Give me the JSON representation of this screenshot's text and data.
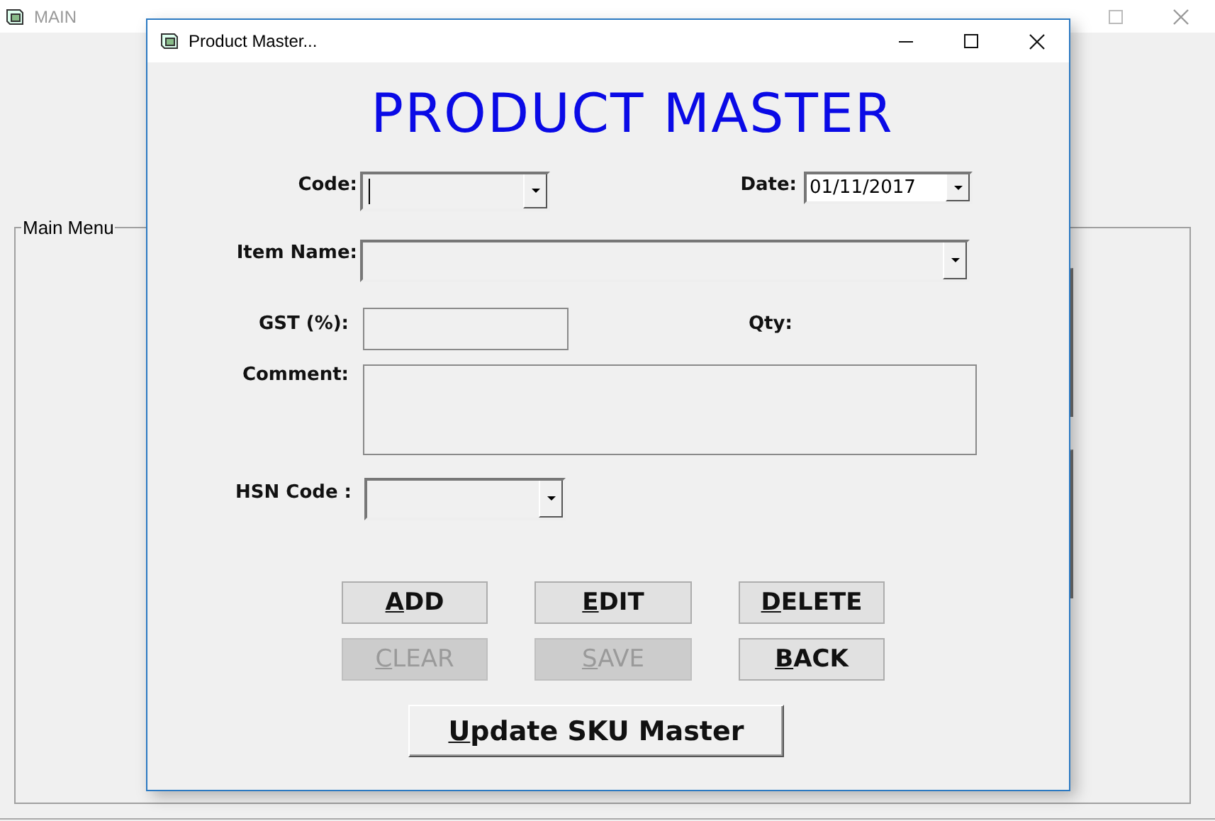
{
  "main_window": {
    "title": "MAIN",
    "group": {
      "label": "Main Menu"
    }
  },
  "dialog": {
    "title": "Product Master...",
    "heading": "PRODUCT MASTER",
    "fields": [
      {
        "kind": "combo",
        "label": "Code:",
        "focused": true
      },
      {
        "kind": "date",
        "label": "Date:",
        "value": "01/11/2017",
        "focused": false
      },
      {
        "kind": "combo",
        "label": "Item Name:",
        "focused": false
      },
      {
        "kind": "text",
        "label": "GST (%):",
        "focused": false
      },
      {
        "kind": "label",
        "label": "Qty:"
      },
      {
        "kind": "memo",
        "label": "Comment:",
        "focused": false
      },
      {
        "kind": "combo",
        "label": "HSN Code :",
        "focused": false
      }
    ],
    "buttons": [
      {
        "label": "ADD",
        "disabled": false
      },
      {
        "label": "EDIT",
        "disabled": false
      },
      {
        "label": "DELETE",
        "disabled": false
      },
      {
        "label": "CLEAR",
        "disabled": true
      },
      {
        "label": "SAVE",
        "disabled": true
      },
      {
        "label": "BACK",
        "disabled": false
      }
    ],
    "update_button": {
      "label": "Update SKU Master"
    }
  }
}
